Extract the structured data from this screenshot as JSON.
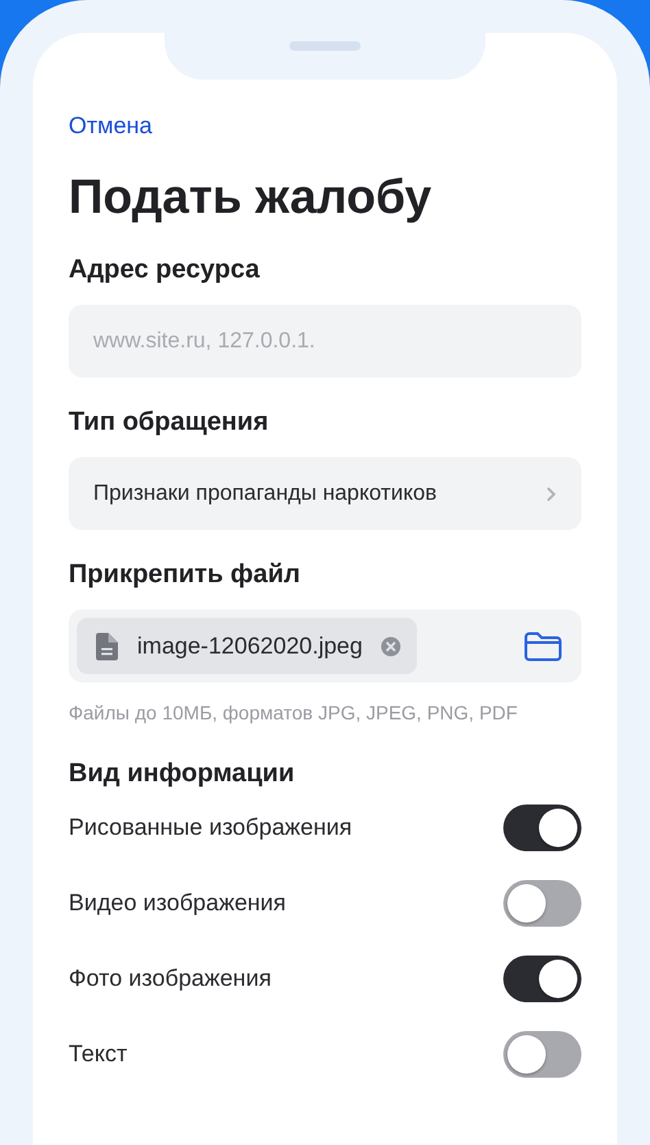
{
  "cancel": "Отмена",
  "title": "Подать жалобу",
  "address": {
    "label": "Адрес ресурса",
    "placeholder": "www.site.ru, 127.0.0.1."
  },
  "request_type": {
    "label": "Тип обращения",
    "value": "Признаки пропаганды наркотиков"
  },
  "attachment": {
    "label": "Прикрепить файл",
    "file_name": "image-12062020.jpeg",
    "hint": "Файлы до 10МБ, форматов JPG, JPEG, PNG, PDF"
  },
  "info_kind": {
    "label": "Вид информации",
    "options": [
      {
        "label": "Рисованные изображения",
        "on": true
      },
      {
        "label": "Видео изображения",
        "on": false
      },
      {
        "label": "Фото изображения",
        "on": true
      },
      {
        "label": "Текст",
        "on": false
      }
    ]
  }
}
